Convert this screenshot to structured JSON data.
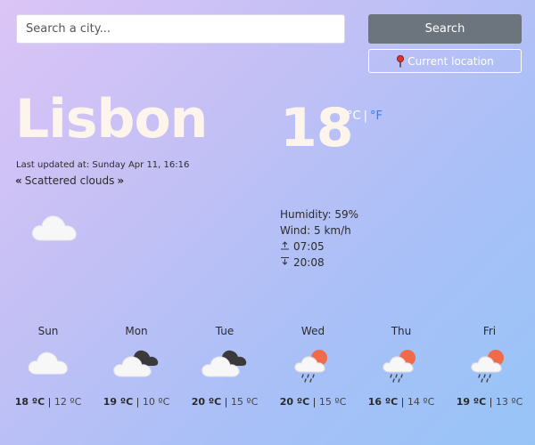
{
  "search": {
    "placeholder": "Search a city...",
    "button_label": "Search"
  },
  "location": {
    "button_label": "Current location"
  },
  "current": {
    "city": "Lisbon",
    "updated": "Last updated at: Sunday Apr 11, 16:16",
    "description": "Scattered clouds",
    "temperature": "18",
    "unit_c": "°C",
    "unit_separator": "|",
    "unit_f": "°F",
    "icon": "cloud-icon",
    "humidity": "Humidity: 59%",
    "wind": "Wind: 5 km/h",
    "sunrise": "07:05",
    "sunset": "20:08"
  },
  "forecast": [
    {
      "day": "Sun",
      "high": "18 ºC",
      "separator": "|",
      "low": "12 ºC",
      "icon": "cloud-icon"
    },
    {
      "day": "Mon",
      "high": "19 ºC",
      "separator": "|",
      "low": "10 ºC",
      "icon": "broken-clouds-icon"
    },
    {
      "day": "Tue",
      "high": "20 ºC",
      "separator": "|",
      "low": "15 ºC",
      "icon": "broken-clouds-icon"
    },
    {
      "day": "Wed",
      "high": "20 ºC",
      "separator": "|",
      "low": "15 ºC",
      "icon": "sun-rain-icon"
    },
    {
      "day": "Thu",
      "high": "16 ºC",
      "separator": "|",
      "low": "14 ºC",
      "icon": "sun-rain-icon"
    },
    {
      "day": "Fri",
      "high": "19 ºC",
      "separator": "|",
      "low": "13 ºC",
      "icon": "sun-rain-icon"
    }
  ],
  "colors": {
    "accent_link": "#2f7cf6",
    "search_button": "#6c757d",
    "headline_text": "#fdf5ec"
  }
}
